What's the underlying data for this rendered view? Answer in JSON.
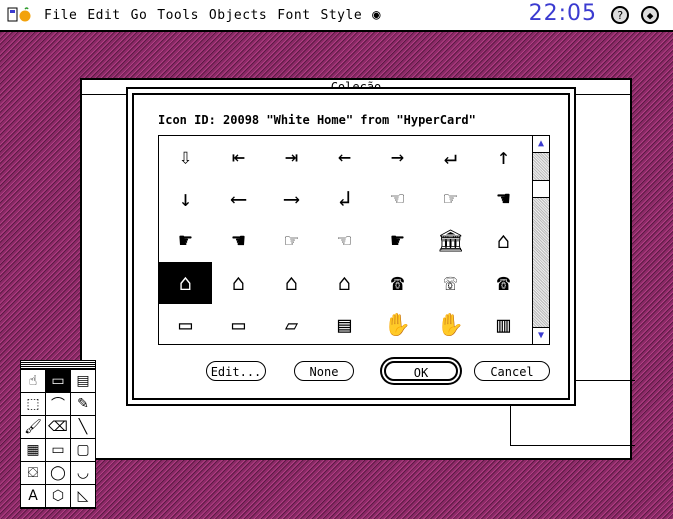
{
  "menubar": {
    "items": [
      "File",
      "Edit",
      "Go",
      "Tools",
      "Objects",
      "Font",
      "Style"
    ],
    "clock": "22:05"
  },
  "card": {
    "title": "Coleção"
  },
  "dialog": {
    "heading": "Icon ID: 20098 \"White Home\" from \"HyperCard\"",
    "icons": [
      [
        "arrow-down-outline-icon",
        "arrow-left-bar-outline-icon",
        "arrow-right-bar-outline-icon",
        "arrow-left-icon",
        "arrow-right-icon",
        "return-arrow-icon",
        "arrow-up-icon"
      ],
      [
        "arrow-down-icon",
        "arrow-left-long-icon",
        "arrow-right-long-icon",
        "return-arrow-long-icon",
        "hand-point-left-small-icon",
        "hand-point-right-small-icon",
        "hand-point-left-icon"
      ],
      [
        "hand-point-right-icon",
        "hand-point-left-large-icon",
        "hand-point-right-medium-icon",
        "hand-point-left-xl-icon",
        "hand-point-right-large-icon",
        "building-icon",
        "home-icon"
      ],
      [
        "white-home-icon",
        "small-home-icon",
        "house-outline-icon",
        "tiny-home-icon",
        "telephone-icon",
        "telephone-outline-icon",
        "telephone-small-icon"
      ],
      [
        "card-icon",
        "card-rings-icon",
        "card-stack-icon",
        "todo-card-icon",
        "hand-card-icon",
        "hand-card-outline-icon",
        "address-book-icon"
      ]
    ],
    "icon_glyphs": [
      [
        "⇩",
        "⇤",
        "⇥",
        "←",
        "→",
        "↵",
        "↑"
      ],
      [
        "↓",
        "⟵",
        "⟶",
        "↲",
        "☜",
        "☞",
        "☚"
      ],
      [
        "☛",
        "☚",
        "☞",
        "☜",
        "☛",
        "🏛",
        "⌂"
      ],
      [
        "⌂",
        "⌂",
        "⌂",
        "⌂",
        "☎",
        "☏",
        "☎"
      ],
      [
        "▭",
        "▭",
        "▱",
        "▤",
        "✋",
        "✋",
        "▥"
      ]
    ],
    "selected": [
      3,
      0
    ],
    "buttons": {
      "edit": "Edit...",
      "none": "None",
      "ok": "OK",
      "cancel": "Cancel"
    }
  },
  "palette": {
    "tools": [
      [
        "browse-hand-icon",
        "button-tool-icon",
        "field-tool-icon"
      ],
      [
        "select-icon",
        "lasso-icon",
        "pencil-icon"
      ],
      [
        "brush-icon",
        "eraser-icon",
        "line-icon"
      ],
      [
        "spray-can-icon",
        "rectangle-icon",
        "rounded-rectangle-icon"
      ],
      [
        "paint-bucket-icon",
        "oval-icon",
        "curve-icon"
      ],
      [
        "text-icon",
        "regular-polygon-icon",
        "polygon-icon"
      ]
    ],
    "glyphs": [
      [
        "☝",
        "▭",
        "▤"
      ],
      [
        "⬚",
        "⌒",
        "✎"
      ],
      [
        "🖌",
        "⌫",
        "╲"
      ],
      [
        "▦",
        "▭",
        "▢"
      ],
      [
        "⛋",
        "◯",
        "◡"
      ],
      [
        "A",
        "⬡",
        "◺"
      ]
    ],
    "selected": [
      0,
      1
    ]
  }
}
